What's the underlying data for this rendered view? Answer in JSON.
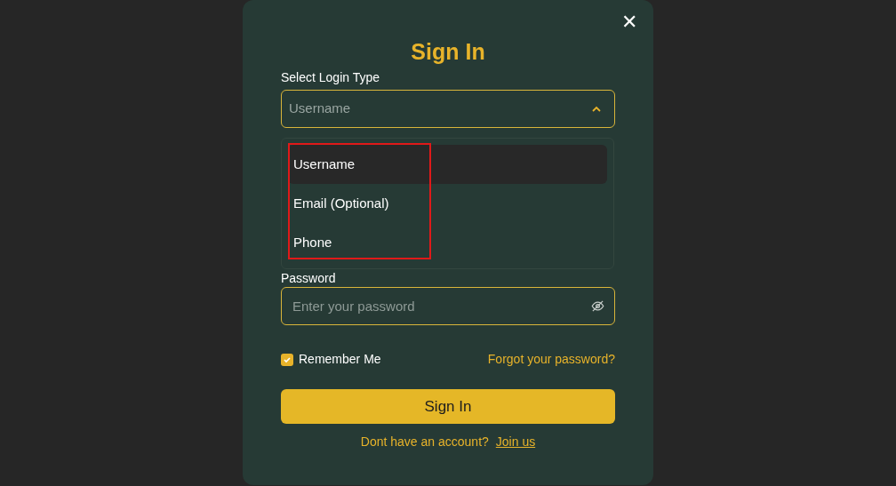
{
  "dialog": {
    "title": "Sign In",
    "close_label": "✕"
  },
  "login_type": {
    "label": "Select Login Type",
    "value": "Username",
    "expanded": true,
    "options": [
      {
        "label": "Username",
        "selected": true
      },
      {
        "label": "Email (Optional)",
        "selected": false
      },
      {
        "label": "Phone",
        "selected": false
      }
    ]
  },
  "password": {
    "label": "Password",
    "placeholder": "Enter your password"
  },
  "remember_me": {
    "label": "Remember Me",
    "checked": true
  },
  "forgot_link": "Forgot your password?",
  "submit": "Sign In",
  "footer": {
    "text": "Dont have an account?",
    "link": "Join us"
  }
}
